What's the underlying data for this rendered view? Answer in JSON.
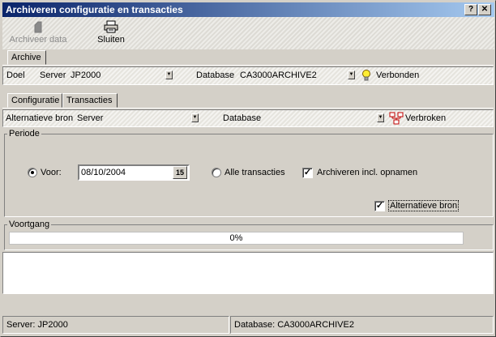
{
  "window": {
    "title": "Archiveren configuratie en transacties",
    "help_glyph": "?",
    "close_glyph": "✕"
  },
  "toolbar": {
    "archive_label": "Archiveer data",
    "close_label": "Sluiten"
  },
  "top_tabs": [
    {
      "label": "Archive"
    }
  ],
  "connection": {
    "doel_label": "Doel",
    "server_label": "Server",
    "server_value": "JP2000",
    "database_label": "Database",
    "database_value": "CA3000ARCHIVE2",
    "status": "Verbonden"
  },
  "sub_tabs": [
    {
      "label": "Configuratie"
    },
    {
      "label": "Transacties"
    }
  ],
  "alt_source": {
    "label": "Alternatieve bron",
    "server_value": "Server",
    "database_value": "Database",
    "status": "Verbroken"
  },
  "periode": {
    "group_label": "Periode",
    "voor_label": "Voor:",
    "date_value": "08/10/2004",
    "calendar_label": "15",
    "alle_label": "Alle transacties",
    "archive_incl_label": "Archiveren incl. opnamen",
    "alt_bron_label": "Alternatieve bron",
    "voor_selected": true,
    "archive_incl_checked": true,
    "alt_bron_checked": true
  },
  "progress": {
    "group_label": "Voortgang",
    "text": "0%",
    "value": 0
  },
  "statusbar": {
    "server": "Server: JP2000",
    "database": "Database: CA3000ARCHIVE2"
  }
}
